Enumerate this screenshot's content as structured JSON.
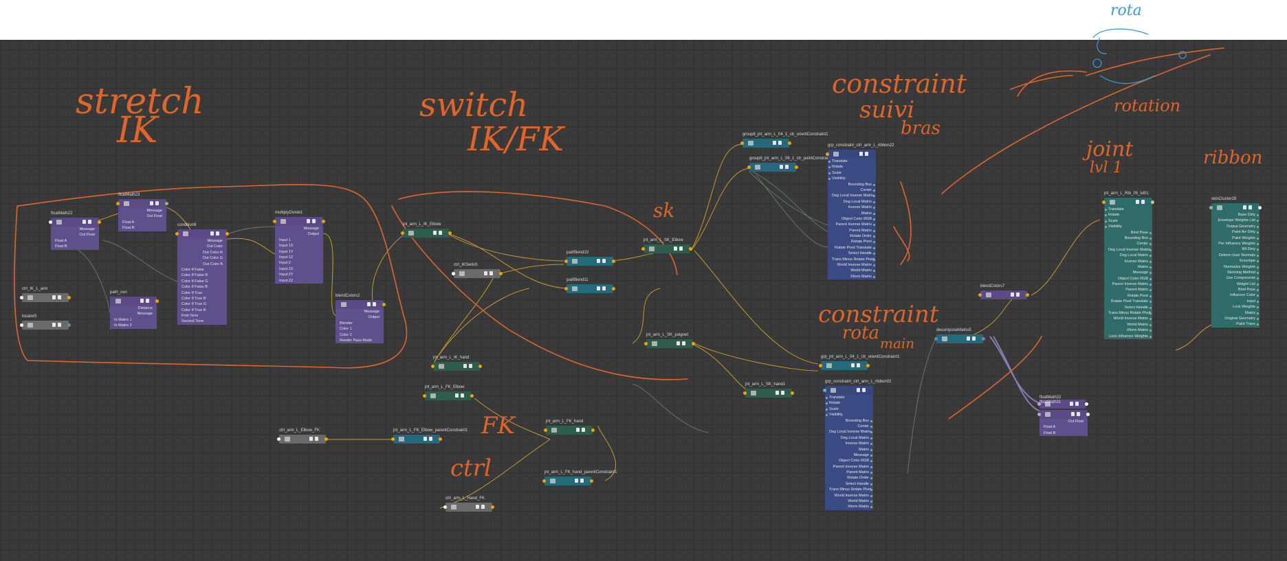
{
  "colors": {
    "canvas": "#3a3a3a",
    "annotation": "#e0652a",
    "wire": "#c89a2a",
    "blue_annotation": "#3a9ad0"
  },
  "annotations": {
    "stretch": "stretch",
    "ik": "IK",
    "switch": "switch",
    "ikfk": "IK/FK",
    "constraint_suivi": "constraint",
    "suivi": "suivi",
    "bras": "bras",
    "sk": "sk",
    "constraint_rota": "constraint",
    "rota_main": "rota",
    "main": "main",
    "fk": "FK",
    "ctrl": "ctrl",
    "joint": "joint",
    "lvl1": "lvl 1",
    "ribbon": "ribbon",
    "rota_top": "rota",
    "rotation": "rotation"
  },
  "nodes": {
    "floatMath22": {
      "title": "floatMath22",
      "attrs": [
        "Message",
        "Out Float",
        "Float A",
        "Float B"
      ]
    },
    "floatMath23": {
      "title": "floatMath23",
      "attrs": [
        "Message",
        "Out Float",
        "Float A",
        "Float B"
      ]
    },
    "condition9": {
      "title": "condition9",
      "attrs": [
        "Message",
        "Out Color",
        "Out Color R",
        "Out Color G",
        "Out Color B",
        "Color If False",
        "Color If False R",
        "Color If False G",
        "Color If False B",
        "Color If True",
        "Color If True R",
        "Color If True G",
        "Color If True B",
        "First Term",
        "Second Term"
      ]
    },
    "multiplyDivide1": {
      "title": "multiplyDivide1",
      "attrs": [
        "Message",
        "Output",
        "Input 1",
        "Input 1X",
        "Input 1Y",
        "Input 1Z",
        "Input 2",
        "Input 2X",
        "Input 2Y",
        "Input 2Z"
      ]
    },
    "blendColors2": {
      "title": "blendColors2",
      "attrs": [
        "Message",
        "Output",
        "Blender",
        "Color 1",
        "Color 2",
        "Render Pass Mode"
      ]
    },
    "ctrl_IK_L_arm": {
      "title": "ctrl_IK_L_arm"
    },
    "locator5": {
      "title": "locator5"
    },
    "path_con": {
      "title": "path_con",
      "attrs": [
        "Distance",
        "Message",
        "In Matrix 1",
        "In Matrix 2"
      ]
    },
    "jnt_arm_L_IK_Elbow": {
      "title": "jnt_arm_L_IK_Elbow"
    },
    "ctrl_IKSwitch": {
      "title": "ctrl_IKSwitch"
    },
    "pairBlend10": {
      "title": "pairBlend10"
    },
    "pairBlend11": {
      "title": "pairBlend11"
    },
    "jnt_arm_L_IK_hand": {
      "title": "jnt_arm_L_IK_hand"
    },
    "jnt_arm_L_FK_Elbow": {
      "title": "jnt_arm_L_FK_Elbow"
    },
    "ctrl_arm_L_Elbow_FK": {
      "title": "ctrl_arm_L_Elbow_FK"
    },
    "jnt_arm_L_FK_Elbow_parentConstraint1": {
      "title": "jnt_arm_L_FK_Elbow_parentConstraint1"
    },
    "jnt_arm_L_FK_hand": {
      "title": "jnt_arm_L_FK_hand"
    },
    "jnt_arm_L_FK_hand_parentConstraint1": {
      "title": "jnt_arm_L_FK_hand_parentConstraint1"
    },
    "ctrl_arm_L_Hand_FK": {
      "title": "ctrl_arm_L_Hand_FK"
    },
    "jnt_arm_L_SK_Elbow": {
      "title": "jnt_arm_L_SK_Elbow"
    },
    "jnt_arm_L_SK_poignet": {
      "title": "jnt_arm_L_SK_poignet"
    },
    "jnt_arm_L_SK_hand1": {
      "title": "jnt_arm_L_SK_hand1"
    },
    "orientConstraint1": {
      "title": "group8_jnt_arm_L_04_1_ctr_orientConstraint1"
    },
    "pointConstraint": {
      "title": "group8_jnt_arm_L_06_1_ctr_pointConstrai"
    },
    "ribbon22": {
      "title": "grp_constraint_ctrl_arm_L_ribbon22",
      "attrs": [
        "Translate",
        "Rotate",
        "Scale",
        "Visibility",
        "Bounding Box",
        "Center",
        "Deg Local Inverse Matrix",
        "Deg Local Matrix",
        "Inverse Matrix",
        "Matrix",
        "Object Color RGB",
        "Parent Inverse Matrix",
        "Parent Matrix",
        "Rotate Order",
        "Rotate Pivot",
        "Rotate Pivot Translate",
        "Select Handle",
        "Trans Minus Rotate Pivot",
        "World Inverse Matrix",
        "World Matrix",
        "Xform Matrix"
      ]
    },
    "orientConstraint1b": {
      "title": "grp_jnt_arm_L_04_1_ctr_orientConstraint1"
    },
    "ribbon02": {
      "title": "grp_constraint_ctrl_arm_L_ribbon02",
      "attrs": [
        "Translate",
        "Rotate",
        "Scale",
        "Visibility",
        "Bounding Box",
        "Center",
        "Deg Local Inverse Matrix",
        "Deg Local Matrix",
        "Inverse Matrix",
        "Matrix",
        "Message",
        "Object Color RGB",
        "Parent Inverse Matrix",
        "Parent Matrix",
        "Rotate Order",
        "Select Handle",
        "Trans Minus Rotate Pivot",
        "World Inverse Matrix",
        "World Matrix",
        "Xform Matrix"
      ]
    },
    "decomposeMatrix5": {
      "title": "decomposeMatrix5"
    },
    "blendColors7": {
      "title": "blendColors7"
    },
    "floatMath31": {
      "title": "floatMath31",
      "attrs": [
        "Out Float",
        "Float A",
        "Float B"
      ]
    },
    "floatMath32": {
      "title": "floatMath32"
    },
    "jnt_arm_L_rib": {
      "title": "jnt_arm_L_Rib_05_lvl01",
      "attrs": [
        "Translate",
        "Rotate",
        "Scale",
        "Visibility",
        "Bind Pose",
        "Bounding Box",
        "Center",
        "Deg Local Inverse Matrix",
        "Deg Local Matrix",
        "Inverse Matrix",
        "Matrix",
        "Message",
        "Object Color RGB",
        "Parent Inverse Matrix",
        "Parent Matrix",
        "Rotate Pivot",
        "Rotate Pivot Translate",
        "Select Handle",
        "Trans Minus Rotate Pivot",
        "World Inverse Matrix",
        "World Matrix",
        "Xform Matrix",
        "Lock Influence Weights"
      ]
    },
    "skinCluster28": {
      "title": "skinCluster28",
      "attrs": [
        "Base Dirty",
        "Envelope Weights List",
        "Output Geometry",
        "Paint Arr Dirty",
        "Paint Weights",
        "Per Influence Weights",
        "Wt Dirty",
        "Deform User Normals",
        "Envelope",
        "Normalize Weights",
        "Skinning Method",
        "Use Components",
        "Weight List",
        "Bind Pose",
        "Influence Color",
        "Input",
        "Lock Weights",
        "Matrix",
        "Original Geometry",
        "Paint Trans"
      ]
    }
  }
}
